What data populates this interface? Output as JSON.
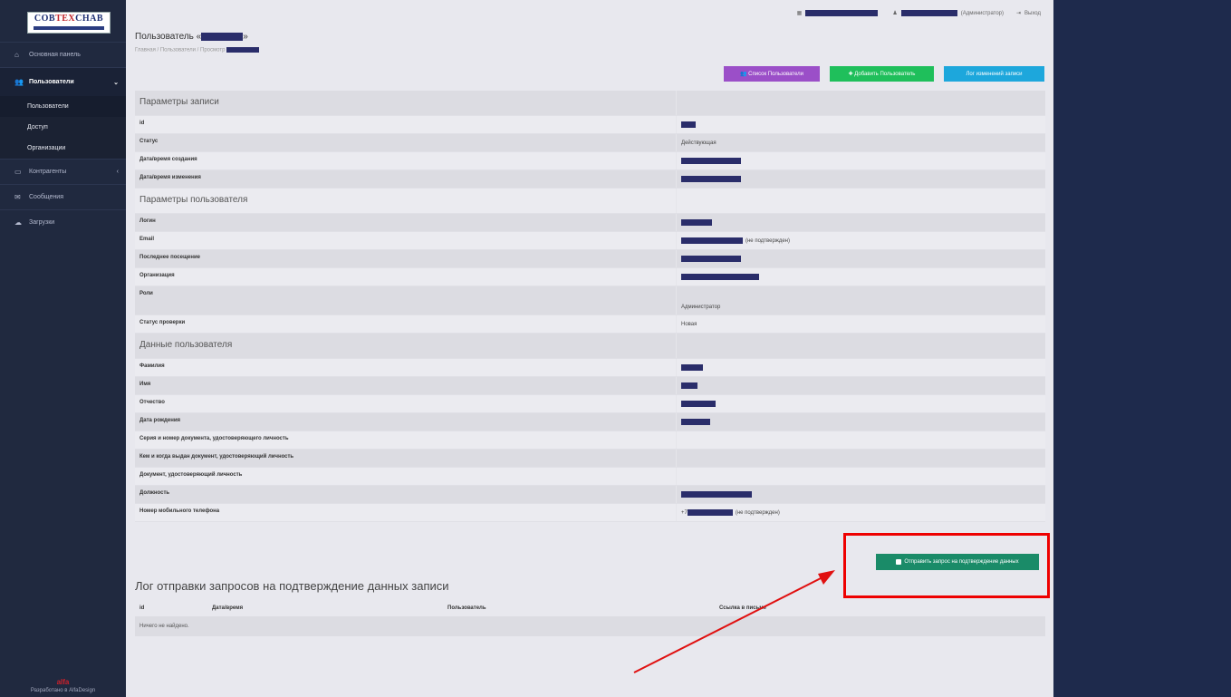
{
  "sidebar": {
    "logo_text_a": "COB",
    "logo_text_b": "TEX",
    "logo_text_c": "CHAB",
    "items": [
      {
        "label": "Основная панель"
      },
      {
        "label": "Пользователи"
      },
      {
        "label": "Контрагенты"
      },
      {
        "label": "Сообщения"
      },
      {
        "label": "Загрузки"
      }
    ],
    "sub_items": [
      {
        "label": "Пользователи"
      },
      {
        "label": "Доступ"
      },
      {
        "label": "Организации"
      }
    ],
    "credit_logo": "alfa",
    "credit": "Разработано в AlfaDesign"
  },
  "topbar": {
    "role": "(Администратор)",
    "logout": "Выход"
  },
  "page": {
    "title": "Пользователь «",
    "title_end": "»",
    "breadcrumb": "Главная / Пользователи / Просмотр"
  },
  "buttons": {
    "list": "Список Пользователи",
    "add": "Добавить Пользователь",
    "log": "Лог изменений записи"
  },
  "sections": {
    "record": "Параметры записи",
    "user": "Параметры пользователя",
    "data": "Данные пользователя"
  },
  "fields": {
    "id": "id",
    "status": "Статус",
    "status_value": "Действующая",
    "created": "Дата/время создания",
    "updated": "Дата/время изменения",
    "login": "Логин",
    "email": "Email",
    "email_note": "(не подтвержден)",
    "last_visit": "Последнее посещение",
    "org": "Организация",
    "roles": "Роли",
    "roles_value": "Администратор",
    "check_status": "Статус проверки",
    "check_status_value": "Новая",
    "surname": "Фамилия",
    "name": "Имя",
    "patronymic": "Отчество",
    "birthdate": "Дата рождения",
    "doc_number": "Серия и номер документа, удостоверяющего личность",
    "doc_issued": "Кем и когда выдан документ, удостоверяющий личность",
    "doc": "Документ, удостоверяющий личность",
    "position": "Должность",
    "phone": "Номер мобильного телефона",
    "phone_prefix": "+7",
    "phone_note": "(не подтвержден)"
  },
  "confirm_button": "Отправить запрос на подтверждение данных",
  "log": {
    "title": "Лог отправки запросов на подтверждение данных записи",
    "columns": [
      "id",
      "Дата/время",
      "Пользователь",
      "Ссылка в письме"
    ],
    "empty": "Ничего не найдено."
  }
}
